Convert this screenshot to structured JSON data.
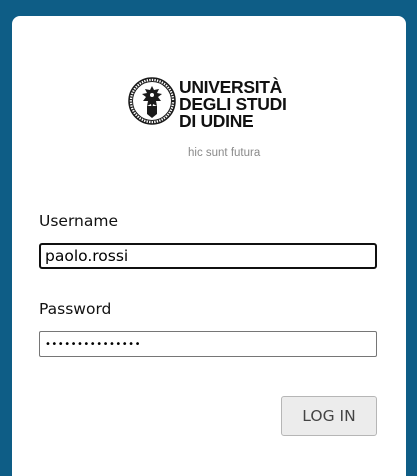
{
  "logo": {
    "icon": "university-seal-icon",
    "line1": "UNIVERSITÀ",
    "line2": "DEGLI STUDI",
    "line3": "DI UDINE",
    "motto": "hic sunt futura"
  },
  "form": {
    "username_label": "Username",
    "username_value": "paolo.rossi",
    "password_label": "Password",
    "password_masked": "•••••••••••••••",
    "login_label": "LOG IN"
  },
  "colors": {
    "background": "#0e5d86",
    "card": "#ffffff",
    "button": "#ececec"
  }
}
